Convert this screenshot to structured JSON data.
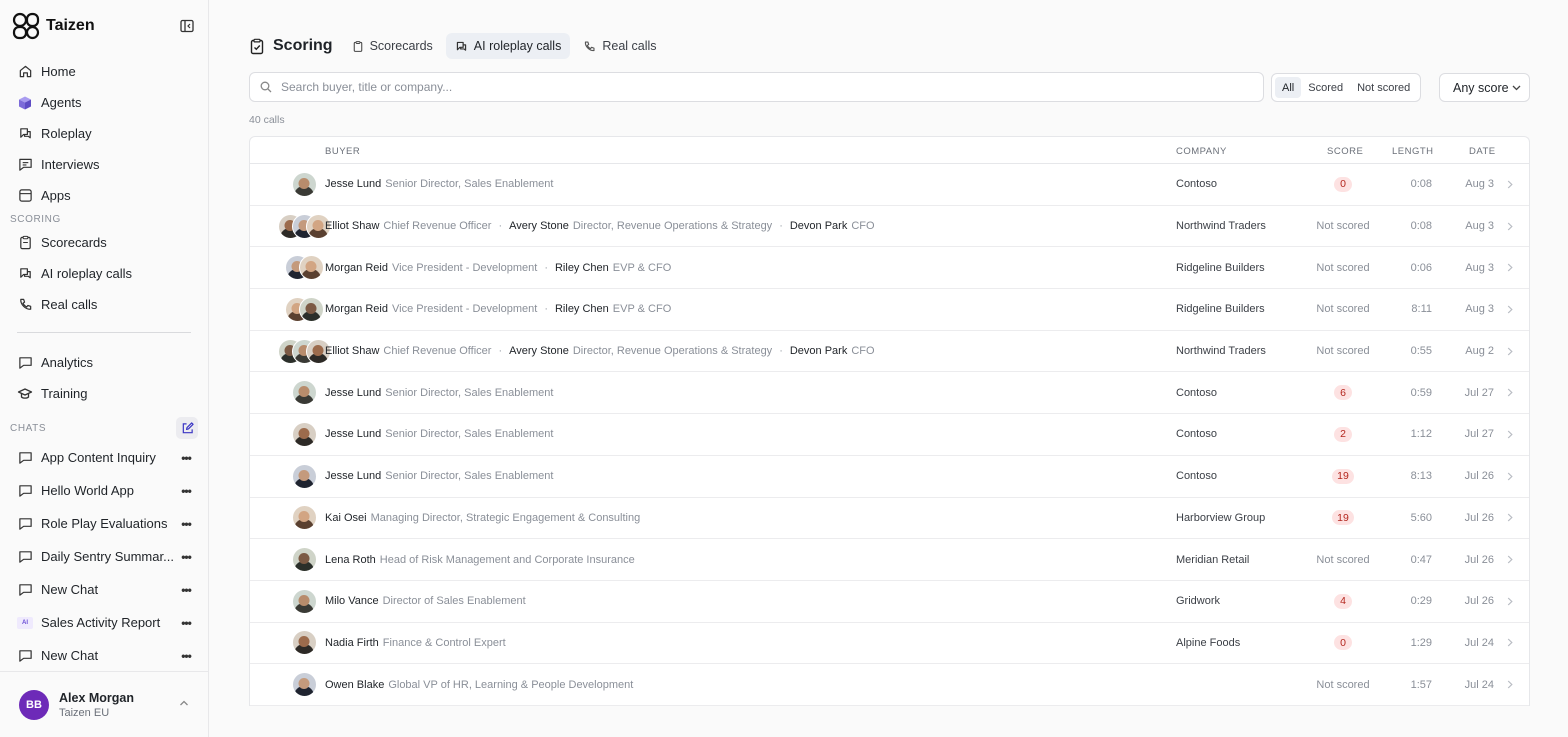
{
  "brand": {
    "name": "Taizen"
  },
  "nav": [
    {
      "label": "Home",
      "icon": "home-icon"
    },
    {
      "label": "Agents",
      "icon": "cube-icon"
    },
    {
      "label": "Roleplay",
      "icon": "roleplay-icon"
    },
    {
      "label": "Interviews",
      "icon": "message-list-icon"
    },
    {
      "label": "Apps",
      "icon": "apps-icon"
    }
  ],
  "scoring_section": {
    "label": "SCORING",
    "items": [
      {
        "label": "Scorecards",
        "icon": "clipboard-icon"
      },
      {
        "label": "AI roleplay calls",
        "icon": "roleplay-icon"
      },
      {
        "label": "Real calls",
        "icon": "phone-icon"
      }
    ]
  },
  "nav2": [
    {
      "label": "Analytics",
      "icon": "chart-icon"
    },
    {
      "label": "Training",
      "icon": "graduation-cap-icon"
    }
  ],
  "chats": {
    "label": "CHATS",
    "items": [
      {
        "label": "App Content Inquiry",
        "icon": "chat-bubble-icon"
      },
      {
        "label": "Hello World App",
        "icon": "chat-bubble-icon"
      },
      {
        "label": "Role Play Evaluations",
        "icon": "chat-bubble-icon"
      },
      {
        "label": "Daily Sentry Summar...",
        "icon": "chat-bubble-icon"
      },
      {
        "label": "New Chat",
        "icon": "chat-bubble-icon"
      },
      {
        "label": "Sales Activity Report",
        "icon": "ai-badge-icon",
        "badge": "AI"
      },
      {
        "label": "New Chat",
        "icon": "chat-bubble-icon"
      }
    ]
  },
  "user": {
    "initials": "BB",
    "name": "Alex Morgan",
    "org": "Taizen EU"
  },
  "header": {
    "title": "Scoring",
    "tabs": [
      {
        "label": "Scorecards",
        "icon": "clipboard-icon",
        "active": false
      },
      {
        "label": "AI roleplay calls",
        "icon": "roleplay-icon",
        "active": true
      },
      {
        "label": "Real calls",
        "icon": "phone-icon",
        "active": false
      }
    ]
  },
  "search": {
    "placeholder": "Search buyer, title or company..."
  },
  "filter": {
    "options": [
      "All",
      "Scored",
      "Not scored"
    ],
    "selected": "All"
  },
  "score_select": {
    "value": "Any score"
  },
  "count_text": "40 calls",
  "colors": {
    "accent": "#6d2ab8",
    "score_pill_bg": "#fde2e2",
    "score_pill_text": "#b3261e"
  },
  "table": {
    "columns": {
      "buyer": "BUYER",
      "company": "COMPANY",
      "score": "SCORE",
      "length": "LENGTH",
      "date": "DATE"
    },
    "rows": [
      {
        "buyers": [
          {
            "name": "Jesse Lund",
            "title": "Senior Director, Sales Enablement"
          }
        ],
        "company": "Contoso",
        "score": "0",
        "scored": true,
        "length": "0:08",
        "date": "Aug 3"
      },
      {
        "buyers": [
          {
            "name": "Elliot Shaw",
            "title": "Chief Revenue Officer"
          },
          {
            "name": "Avery Stone",
            "title": "Director, Revenue Operations & Strategy"
          },
          {
            "name": "Devon Park",
            "title": "CFO"
          }
        ],
        "company": "Northwind Traders",
        "score": "Not scored",
        "scored": false,
        "length": "0:08",
        "date": "Aug 3"
      },
      {
        "buyers": [
          {
            "name": "Morgan Reid",
            "title": "Vice President - Development"
          },
          {
            "name": "Riley Chen",
            "title": "EVP & CFO"
          }
        ],
        "company": "Ridgeline Builders",
        "score": "Not scored",
        "scored": false,
        "length": "0:06",
        "date": "Aug 3"
      },
      {
        "buyers": [
          {
            "name": "Morgan Reid",
            "title": "Vice President - Development"
          },
          {
            "name": "Riley Chen",
            "title": "EVP & CFO"
          }
        ],
        "company": "Ridgeline Builders",
        "score": "Not scored",
        "scored": false,
        "length": "8:11",
        "date": "Aug 3"
      },
      {
        "buyers": [
          {
            "name": "Elliot Shaw",
            "title": "Chief Revenue Officer"
          },
          {
            "name": "Avery Stone",
            "title": "Director, Revenue Operations & Strategy"
          },
          {
            "name": "Devon Park",
            "title": "CFO"
          }
        ],
        "company": "Northwind Traders",
        "score": "Not scored",
        "scored": false,
        "length": "0:55",
        "date": "Aug 2"
      },
      {
        "buyers": [
          {
            "name": "Jesse Lund",
            "title": "Senior Director, Sales Enablement"
          }
        ],
        "company": "Contoso",
        "score": "6",
        "scored": true,
        "length": "0:59",
        "date": "Jul 27"
      },
      {
        "buyers": [
          {
            "name": "Jesse Lund",
            "title": "Senior Director, Sales Enablement"
          }
        ],
        "company": "Contoso",
        "score": "2",
        "scored": true,
        "length": "1:12",
        "date": "Jul 27"
      },
      {
        "buyers": [
          {
            "name": "Jesse Lund",
            "title": "Senior Director, Sales Enablement"
          }
        ],
        "company": "Contoso",
        "score": "19",
        "scored": true,
        "length": "8:13",
        "date": "Jul 26"
      },
      {
        "buyers": [
          {
            "name": "Kai Osei",
            "title": "Managing Director, Strategic Engagement & Consulting"
          }
        ],
        "company": "Harborview Group",
        "score": "19",
        "scored": true,
        "length": "5:60",
        "date": "Jul 26"
      },
      {
        "buyers": [
          {
            "name": "Lena Roth",
            "title": "Head of Risk Management and Corporate Insurance"
          }
        ],
        "company": "Meridian Retail",
        "score": "Not scored",
        "scored": false,
        "length": "0:47",
        "date": "Jul 26"
      },
      {
        "buyers": [
          {
            "name": "Milo Vance",
            "title": "Director of Sales Enablement"
          }
        ],
        "company": "Gridwork",
        "score": "4",
        "scored": true,
        "length": "0:29",
        "date": "Jul 26"
      },
      {
        "buyers": [
          {
            "name": "Nadia Firth",
            "title": "Finance & Control Expert"
          }
        ],
        "company": "Alpine Foods",
        "score": "0",
        "scored": true,
        "length": "1:29",
        "date": "Jul 24"
      },
      {
        "buyers": [
          {
            "name": "Owen Blake",
            "title": "Global VP of HR, Learning & People Development"
          }
        ],
        "company": "",
        "score": "Not scored",
        "scored": false,
        "length": "1:57",
        "date": "Jul 24"
      }
    ]
  }
}
